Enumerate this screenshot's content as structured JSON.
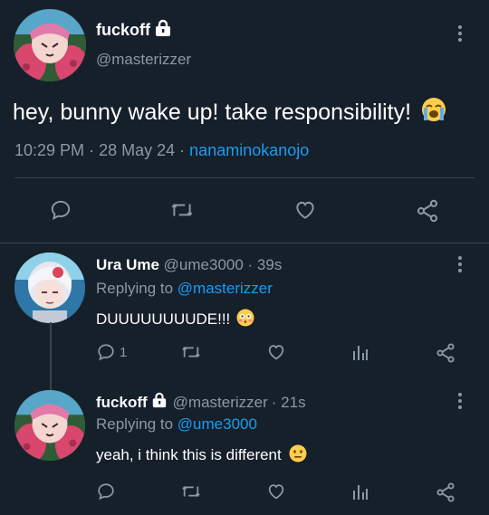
{
  "main_tweet": {
    "display_name": "fuckoff",
    "handle": "@masterizzer",
    "text": "hey, bunny wake up! take responsibility!",
    "time": "10:29 PM",
    "sep1": "·",
    "date": "28 May 24",
    "sep2": "·",
    "via": "nanaminokanojo",
    "emoji": "loudly-crying-face"
  },
  "reply1": {
    "display_name": "Ura Ume",
    "handle": "@ume3000",
    "time": "· 39s",
    "replying_prefix": "Replying to",
    "replying_to": "@masterizzer",
    "text": "DUUUUUUUUDE!!!",
    "emoji": "flushed-face",
    "reply_count": "1"
  },
  "reply2": {
    "display_name": "fuckoff",
    "handle": "@masterizzer",
    "time": "· 21s",
    "replying_prefix": "Replying to",
    "replying_to": "@ume3000",
    "text": "yeah, i think this is different",
    "emoji": "neutral-face"
  },
  "colors": {
    "background": "#15202b",
    "muted": "#8b98a5",
    "link": "#1d9bf0",
    "divider": "#38444d"
  }
}
